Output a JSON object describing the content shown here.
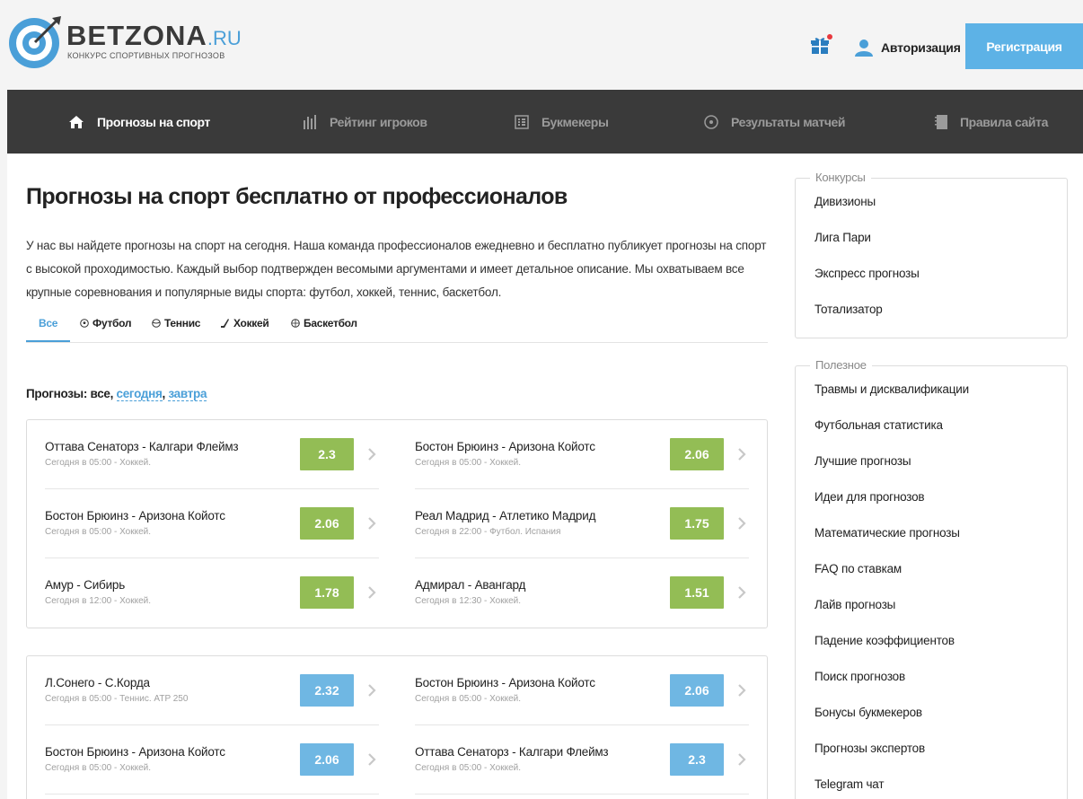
{
  "header": {
    "logo_main": "BETZONA",
    "logo_domain": ".RU",
    "logo_tagline": "КОНКУРС СПОРТИВНЫХ ПРОГНОЗОВ",
    "auth_label": "Авторизация",
    "register_label": "Регистрация",
    "gift_badge_color": "#e8383d"
  },
  "nav": {
    "items": [
      {
        "label": "Прогнозы на спорт",
        "icon": "home-icon",
        "active": true
      },
      {
        "label": "Рейтинг игроков",
        "icon": "bar-chart-icon",
        "active": false
      },
      {
        "label": "Букмекеры",
        "icon": "list-icon",
        "active": false
      },
      {
        "label": "Результаты матчей",
        "icon": "clock-icon",
        "active": false
      },
      {
        "label": "Правила сайта",
        "icon": "notebook-icon",
        "active": false
      }
    ]
  },
  "main": {
    "title": "Прогнозы на спорт бесплатно от профессионалов",
    "intro": "У нас вы найдете прогнозы на спорт на сегодня. Наша команда профессионалов ежедневно и бесплатно публикует прогнозы на спорт с высокой проходимостью. Каждый выбор подтвержден весомыми аргументами и имеет детальное описание. Мы охватываем все крупные соревнования и популярные виды спорта: футбол, хоккей, теннис, баскетбол.",
    "tabs": [
      {
        "label": "Все",
        "icon": ""
      },
      {
        "label": "Футбол",
        "icon": "soccer-ball-icon"
      },
      {
        "label": "Теннис",
        "icon": "tennis-ball-icon"
      },
      {
        "label": "Хоккей",
        "icon": "hockey-stick-icon"
      },
      {
        "label": "Баскетбол",
        "icon": "basketball-icon"
      }
    ],
    "filter": {
      "prefix": "Прогнозы: все, ",
      "today": "сегодня",
      "sep": ", ",
      "tomorrow": "завтра"
    },
    "groups": [
      {
        "odd_color": "#93bd55",
        "rows": [
          {
            "match": "Оттава Сенаторз - Калгари Флеймз",
            "meta": "Сегодня в 05:00 - Хоккей.",
            "odd": "2.3"
          },
          {
            "match": "Бостон Брюинз - Аризона Койотс",
            "meta": "Сегодня в 05:00 - Хоккей.",
            "odd": "2.06"
          },
          {
            "match": "Бостон Брюинз - Аризона Койотс",
            "meta": "Сегодня в 05:00 - Хоккей.",
            "odd": "2.06"
          },
          {
            "match": "Реал Мадрид - Атлетико Мадрид",
            "meta": "Сегодня в 22:00 - Футбол. Испания",
            "odd": "1.75"
          },
          {
            "match": "Амур - Сибирь",
            "meta": "Сегодня в 12:00 - Хоккей.",
            "odd": "1.78"
          },
          {
            "match": "Адмирал - Авангард",
            "meta": "Сегодня в 12:30 - Хоккей.",
            "odd": "1.51"
          }
        ]
      },
      {
        "odd_color": "#6fb7e3",
        "rows": [
          {
            "match": "Л.Сонего - С.Корда",
            "meta": "Сегодня в 05:00 - Теннис. ATP 250",
            "odd": "2.32"
          },
          {
            "match": "Бостон Брюинз - Аризона Койотс",
            "meta": "Сегодня в 05:00 - Хоккей.",
            "odd": "2.06"
          },
          {
            "match": "Бостон Брюинз - Аризона Койотс",
            "meta": "Сегодня в 05:00 - Хоккей.",
            "odd": "2.06"
          },
          {
            "match": "Оттава Сенаторз - Калгари Флеймз",
            "meta": "Сегодня в 05:00 - Хоккей.",
            "odd": "2.3"
          }
        ]
      }
    ]
  },
  "sidebar": {
    "contests": {
      "legend": "Конкурсы",
      "items": [
        "Дивизионы",
        "Лига Пари",
        "Экспресс прогнозы",
        "Тотализатор"
      ]
    },
    "useful": {
      "legend": "Полезное",
      "items": [
        "Травмы и дисквалификации",
        "Футбольная статистика",
        "Лучшие прогнозы",
        "Идеи для прогнозов",
        "Математические прогнозы",
        "FAQ по ставкам",
        "Лайв прогнозы",
        "Падение коэффициентов",
        "Поиск прогнозов",
        "Бонусы букмекеров",
        "Прогнозы экспертов",
        "Telegram чат"
      ]
    }
  },
  "colors": {
    "accent": "#4a9fd8",
    "nav_bg": "#3a3a3a",
    "register_bg": "#5db2e6"
  }
}
